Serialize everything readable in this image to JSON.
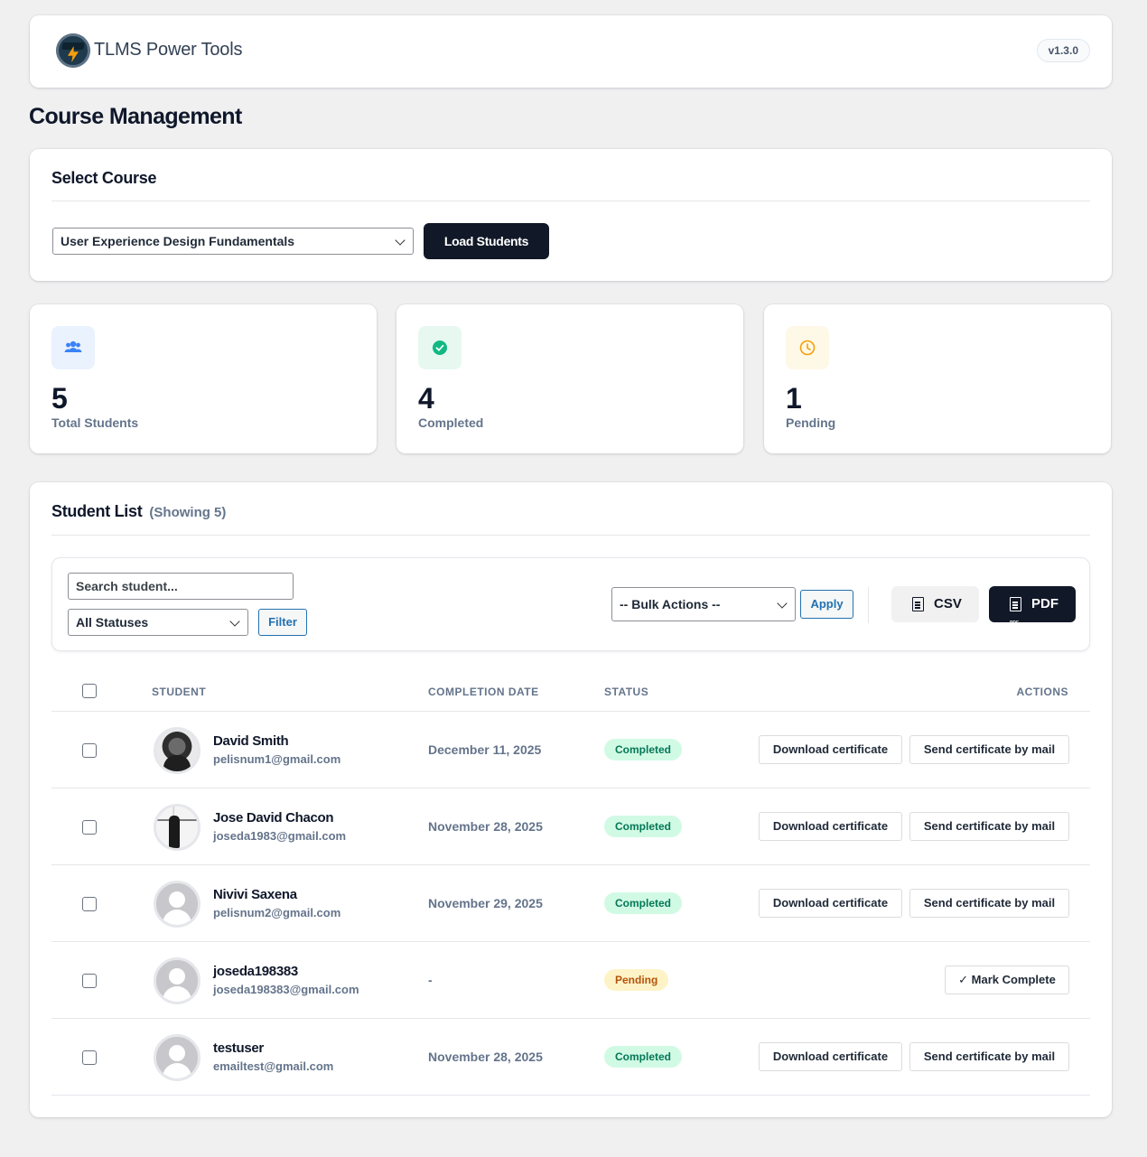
{
  "header": {
    "brand": "TLMS Power Tools",
    "version": "v1.3.0"
  },
  "page": {
    "title": "Course Management"
  },
  "course": {
    "section_title": "Select Course",
    "selected": "User Experience Design Fundamentals",
    "load_label": "Load Students"
  },
  "stats": [
    {
      "value": "5",
      "label": "Total Students",
      "icon": "users-icon",
      "color": "#3b82f6"
    },
    {
      "value": "4",
      "label": "Completed",
      "icon": "check-circle-icon",
      "color": "#10b981"
    },
    {
      "value": "1",
      "label": "Pending",
      "icon": "clock-icon",
      "color": "#f59e0b"
    }
  ],
  "list": {
    "title": "Student List",
    "subtitle": "(Showing 5)",
    "search_placeholder": "Search student...",
    "status_filter": "All Statuses",
    "filter_label": "Filter",
    "bulk_actions": "-- Bulk Actions --",
    "apply_label": "Apply",
    "csv_label": "CSV",
    "pdf_label": "PDF",
    "columns": {
      "student": "STUDENT",
      "date": "COMPLETION DATE",
      "status": "STATUS",
      "actions": "ACTIONS"
    },
    "download_label": "Download certificate",
    "mail_label": "Send certificate by mail",
    "mark_label": "✓ Mark Complete",
    "students": [
      {
        "name": "David Smith",
        "email": "pelisnum1@gmail.com",
        "date": "December 11, 2025",
        "status": "Completed"
      },
      {
        "name": "Jose David Chacon",
        "email": "joseda1983@gmail.com",
        "date": "November 28, 2025",
        "status": "Completed"
      },
      {
        "name": "Nivivi Saxena",
        "email": "pelisnum2@gmail.com",
        "date": "November 29, 2025",
        "status": "Completed"
      },
      {
        "name": "joseda198383",
        "email": "joseda198383@gmail.com",
        "date": "-",
        "status": "Pending"
      },
      {
        "name": "testuser",
        "email": "emailtest@gmail.com",
        "date": "November 28, 2025",
        "status": "Completed"
      }
    ]
  }
}
